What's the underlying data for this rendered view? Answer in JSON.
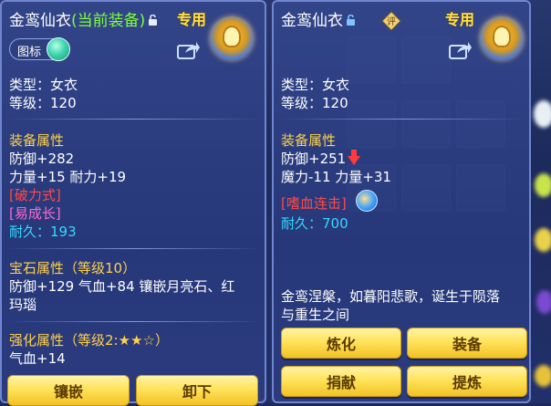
{
  "left_panel": {
    "item_name": "金鸾仙衣",
    "current_tag": "(当前装备)",
    "exclusive": "专用",
    "toggle_label": "图标",
    "type_line": "类型：女衣",
    "level_line": "等级：120",
    "equip_attr_title": "装备属性",
    "defense_line": "防御+282",
    "stats_line": "力量+15 耐力+19",
    "special_1": "[破力式]",
    "special_2": "[易成长]",
    "durability_line": "耐久：193",
    "gem_title": "宝石属性（等级10）",
    "gem_line_1": "防御+129 气血+84 镶嵌月亮石、红",
    "gem_line_2": "玛瑙",
    "enhance_title": "强化属性（等级2:★★☆）",
    "enhance_line": "气血+14",
    "buttons": {
      "inlay": "镶嵌",
      "unequip": "卸下"
    }
  },
  "right_panel": {
    "item_name": "金鸾仙衣",
    "exclusive": "专用",
    "badge": "评",
    "type_line": "类型：女衣",
    "level_line": "等级：120",
    "equip_attr_title": "装备属性",
    "defense_line": "防御+251",
    "stats_line": "魔力-11 力量+31",
    "special_1": "[嗜血连击]",
    "durability_line": "耐久：700",
    "description": "金鸾涅槃，如暮阳悲歌，诞生于陨落",
    "description_2": "与重生之间",
    "buttons": {
      "refine": "炼化",
      "equip": "装备",
      "donate": "捐献",
      "extract": "提炼"
    }
  },
  "colors": {
    "name_white": "#ffffff",
    "current_green": "#7cff3a",
    "section_gold": "#ffd24a",
    "durability_cyan": "#35d8ff",
    "special_red": "#ff4a4a",
    "special_pink": "#ff6ad0",
    "button_yellow": "#ffe35a"
  }
}
